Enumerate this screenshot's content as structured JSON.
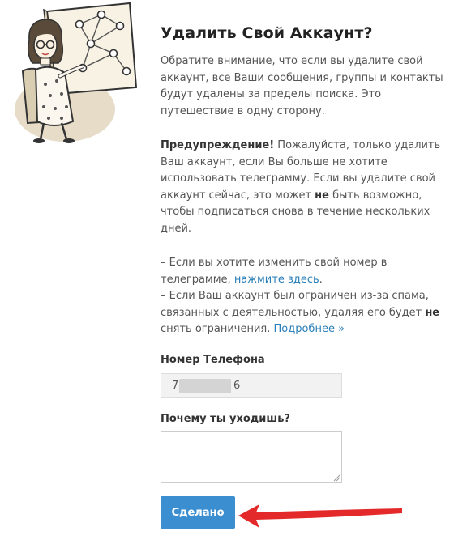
{
  "page": {
    "title": "Удалить Свой Аккаунт?",
    "intro": "Обратите внимание, что если вы удалите свой аккаунт, все Ваши сообщения, группы и контакты будут удалены за пределы поиска. Это путешествие в одну сторону.",
    "warning": {
      "lead": "Предупреждение!",
      "text1": " Пожалуйста, только удалить Ваш аккаунт, если Вы больше не хотите использовать телеграмму. Если вы удалите свой аккаунт сейчас, это может ",
      "bold": "не",
      "text2": " быть возможно, чтобы подписаться снова в течение нескольких дней."
    },
    "notes": {
      "change_number_text": "– Если вы хотите изменить свой номер в телеграмме, ",
      "change_number_link": "нажмите здесь",
      "change_number_end": ".",
      "spam_text1": "– Если Ваш аккаунт был ограничен из-за спама, связанных с деятельностью, удаляя его будет ",
      "spam_bold": "не",
      "spam_text2": " снять ограничения. ",
      "spam_link": "Подробнее »"
    }
  },
  "form": {
    "phone_label": "Номер Телефона",
    "phone_start": "7",
    "phone_end": "6",
    "reason_label": "Почему ты уходишь?",
    "reason_value": "",
    "submit_label": "Сделано"
  },
  "colors": {
    "button": "#3b8fd0",
    "link": "#2a7fb8",
    "arrow": "#e32929"
  },
  "icons": {
    "illustration": "woman-at-network-map-illustration",
    "annotation": "red-arrow-pointer"
  }
}
